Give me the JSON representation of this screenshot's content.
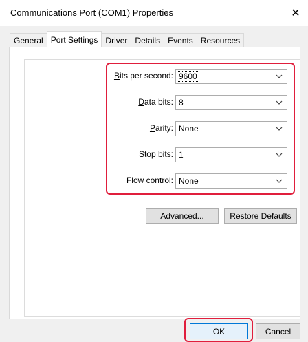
{
  "window": {
    "title": "Communications Port (COM1) Properties",
    "close_glyph": "✕"
  },
  "tabs": [
    {
      "label": "General"
    },
    {
      "label": "Port Settings",
      "active": true
    },
    {
      "label": "Driver"
    },
    {
      "label": "Details"
    },
    {
      "label": "Events"
    },
    {
      "label": "Resources"
    }
  ],
  "settings": {
    "bits_per_second": {
      "accel": "B",
      "rest": "its per second:",
      "value": "9600"
    },
    "data_bits": {
      "accel": "D",
      "rest": "ata bits:",
      "value": "8"
    },
    "parity": {
      "pre": "",
      "accel": "P",
      "rest": "arity:",
      "value": "None"
    },
    "stop_bits": {
      "accel": "S",
      "rest": "top bits:",
      "value": "1"
    },
    "flow_control": {
      "accel": "F",
      "rest": "low control:",
      "value": "None"
    }
  },
  "buttons": {
    "advanced": {
      "accel": "A",
      "rest": "dvanced..."
    },
    "restore": {
      "accel": "R",
      "rest": "estore Defaults"
    },
    "ok": "OK",
    "cancel": "Cancel"
  },
  "colors": {
    "highlight": "#e01e3c",
    "panel": "#ffffff",
    "dialog": "#f0f0f0"
  },
  "icons": {
    "dropdown": "chevron-down-icon",
    "close": "close-icon"
  }
}
